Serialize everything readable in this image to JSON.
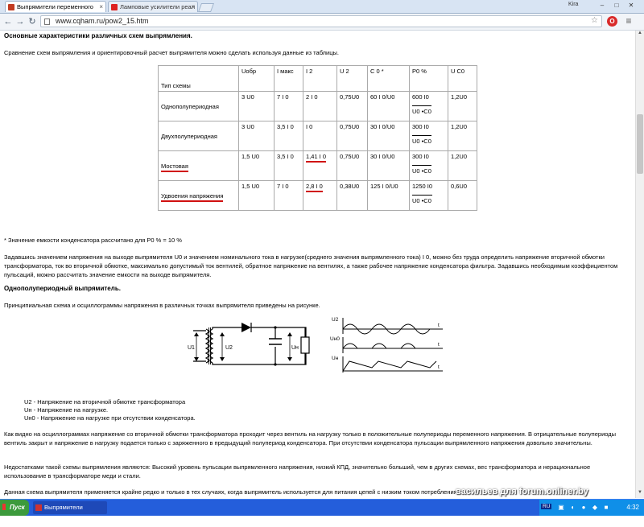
{
  "browser": {
    "tabs": [
      {
        "title": "Выпрямители переменного",
        "icon": "site-favicon",
        "active": true
      },
      {
        "title": "Ламповые усилители реал",
        "icon": "site-favicon",
        "active": false
      }
    ],
    "user": "Kira",
    "url": "www.cqham.ru/pow2_15.htm",
    "window_controls": {
      "minimize": "–",
      "maximize": "□",
      "close": "✕"
    },
    "opera_label": "O"
  },
  "page": {
    "heading1": "Основные характеристики различных схем выпрямления.",
    "intro": "Сравнение схем выпрямления и ориентировочный расчет выпрямителя можно сделать используя данные из таблицы.",
    "table": {
      "headers": [
        "Тип схемы",
        "Uобр",
        "I макс",
        "I 2",
        "U 2",
        "C 0 *",
        "P0 %",
        "U C0"
      ],
      "rows": [
        {
          "type": "Однополупериодная",
          "uobr": "3 U0",
          "imax": "7 I 0",
          "i2": "2 I 0",
          "u2": "0,75U0",
          "c0": "60 I 0/U0",
          "p0_top": "600 I0",
          "p0_bot": "U0 •C0",
          "uc0": "1,2U0",
          "type_red": false,
          "i2_red": false
        },
        {
          "type": "Двухполупериодная",
          "uobr": "3 U0",
          "imax": "3,5 I 0",
          "i2": "I 0",
          "u2": "0,75U0",
          "c0": "30 I 0/U0",
          "p0_top": "300 I0",
          "p0_bot": "U0 •C0",
          "uc0": "1,2U0",
          "type_red": false,
          "i2_red": false
        },
        {
          "type": "Мостовая",
          "uobr": "1,5 U0",
          "imax": "3,5 I 0",
          "i2": "1,41 I 0",
          "u2": "0,75U0",
          "c0": "30 I 0/U0",
          "p0_top": "300 I0",
          "p0_bot": "U0 •C0",
          "uc0": "1,2U0",
          "type_red": true,
          "i2_red": true
        },
        {
          "type": "Удвоения напряжения",
          "uobr": "1,5 U0",
          "imax": "7 I 0",
          "i2": "2,8 I 0",
          "u2": "0,38U0",
          "c0": "125 I 0/U0",
          "p0_top": "1250 I0",
          "p0_bot": "U0 •C0",
          "uc0": "0,6U0",
          "type_red": true,
          "i2_red": true
        }
      ]
    },
    "footnote": "* Значение емкости конденсатора рассчитано для P0 % = 10 %",
    "para1": "Задавшись значением напряжения на выходе выпрямителя U0 и значением номинального тока в нагрузке(среднего значения выпрямленного тока) I 0, можно без труда определить напряжение вторичной обмотки трансформатора, ток во вторичной обмотке, максимально допустимый ток вентилей, обратное напряжение на вентилях, а также рабочее напряжение конденсатора фильтра. Задавшись необходимым коэффициентом пульсаций, можно рассчитать значение емкости на выходе выпрямителя.",
    "heading2": "Однополупериодный выпрямитель.",
    "para2": "Принципиальная схема и осциллограммы напряжения в различных точках выпрямителя приведены на рисунке.",
    "circuit_labels": {
      "u1": "U1",
      "u2": "U2",
      "un": "Uн"
    },
    "scope_labels": {
      "u2": "U2",
      "un0": "Uн0",
      "un": "Uн",
      "t": "t"
    },
    "legend": [
      "U2 - Напряжение на вторичной обмотке трансформатора",
      "Uн - Напряжение на нагрузке.",
      "Uн0 - Напряжение на нагрузке при отсутствии конденсатора."
    ],
    "para3": "Как видно на осциллограммах напряжение со вторичной обмотки трансформатора проходит через вентиль на нагрузку только в положительные полупериоды переменного напряжения. В отрицательные полупериоды вентиль закрыт и напряжение в нагрузку подается только с заряженного в предыдущий полупериод конденсатора. При отсутствии конденсатора пульсации выпрямленного напряжения довольно значительны.",
    "para4": "Недостатками такой схемы выпрямления являются: Высокий уровень пульсации выпрямленного напряжения, низкий КПД, значительно больший, чем в других схемах, вес трансформатора и нерациональное использование в трансформаторе меди и стали.",
    "para5": "Данная схема выпрямителя применяется крайне редко и только в тех случаях, когда выпрямитель используется для питания цепей с низким током потребления."
  },
  "taskbar": {
    "start": "Пуск",
    "task": "Выпрямители перемен...",
    "lang": "RU",
    "clock": "4:32"
  },
  "watermark": "васильев для forum.onliner.by",
  "colors": {
    "accent_red": "#d01010",
    "taskbar": "#245edb",
    "tray": "#0f8fe8"
  }
}
